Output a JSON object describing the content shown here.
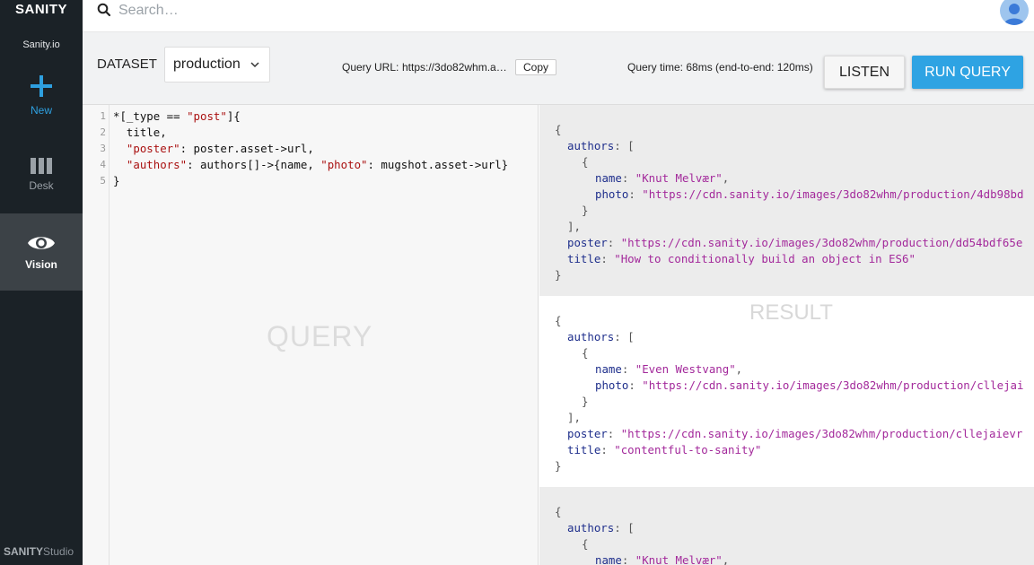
{
  "sidebar": {
    "brand": "SANITY",
    "site_name": "Sanity.io",
    "tools": [
      {
        "label": "New",
        "icon": "plus-icon"
      },
      {
        "label": "Desk",
        "icon": "desk-columns-icon"
      },
      {
        "label": "Vision",
        "icon": "eye-icon"
      }
    ],
    "studio_brand": "SANITY",
    "studio_suffix": "Studio"
  },
  "search": {
    "placeholder": "Search…",
    "icon": "search-icon"
  },
  "user": {
    "avatar_icon": "user-avatar-icon"
  },
  "dataset": {
    "label": "DATASET",
    "selected": "production"
  },
  "query_url": {
    "label": "Query URL:",
    "value": "https://3do82whm.a…",
    "copy_label": "Copy"
  },
  "query_time": "Query time: 68ms (end-to-end: 120ms)",
  "buttons": {
    "listen": "LISTEN",
    "run": "RUN QUERY"
  },
  "query": {
    "watermark": "QUERY",
    "line_numbers": [
      "1",
      "2",
      "3",
      "4",
      "5"
    ],
    "lines": [
      [
        "*[_type == ",
        "\"post\"",
        "]{"
      ],
      [
        "  title,"
      ],
      [
        "  ",
        "\"poster\"",
        ": poster.asset->url,"
      ],
      [
        "  ",
        "\"authors\"",
        ": authors[]->{name, ",
        "\"photo\"",
        ": mugshot.asset->url}"
      ],
      [
        "}"
      ]
    ]
  },
  "result": {
    "watermark": "RESULT",
    "items": [
      {
        "author_name": "\"Knut Melvær\"",
        "author_photo": "\"https://cdn.sanity.io/images/3do82whm/production/4db98bd",
        "poster": "\"https://cdn.sanity.io/images/3do82whm/production/dd54bdf65e",
        "title": "\"How to conditionally build an object in ES6\""
      },
      {
        "author_name": "\"Even Westvang\"",
        "author_photo": "\"https://cdn.sanity.io/images/3do82whm/production/cllejai",
        "poster": "\"https://cdn.sanity.io/images/3do82whm/production/cllejaievr",
        "title": "\"contentful-to-sanity\""
      },
      {
        "author_name": "\"Knut Melvær\""
      }
    ],
    "keys": {
      "authors": "authors",
      "name": "name",
      "photo": "photo",
      "poster": "poster",
      "title": "title"
    }
  },
  "colors": {
    "accent": "#2ea3e3",
    "sidebar_bg": "#1b2227",
    "active_tool_bg": "#3c4247"
  }
}
